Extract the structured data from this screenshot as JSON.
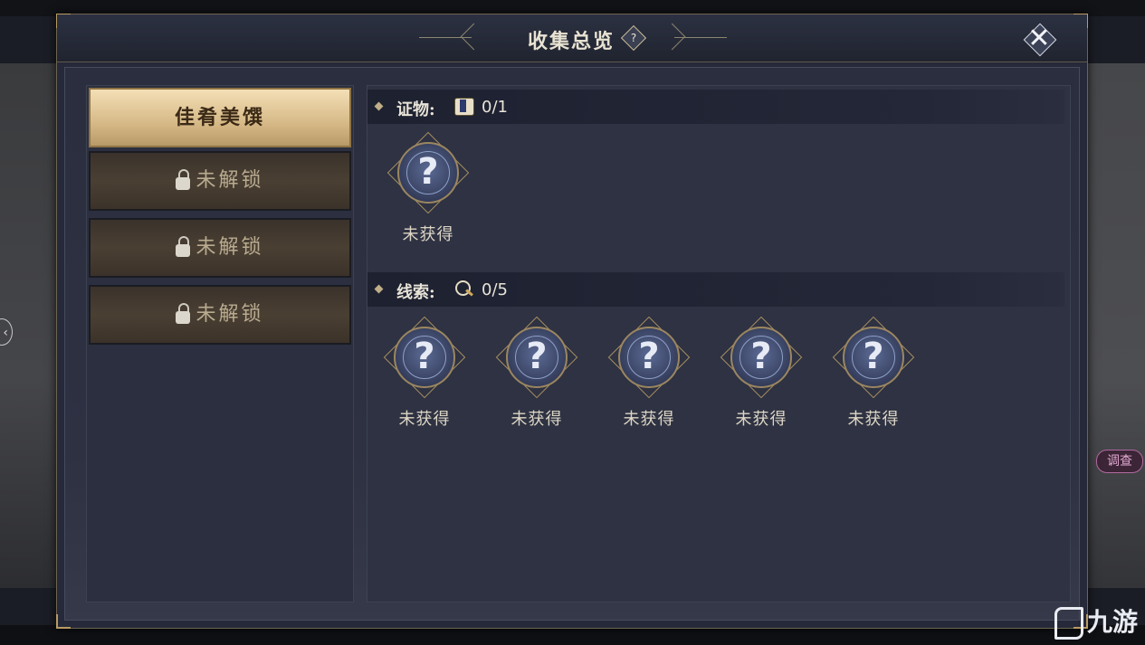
{
  "modal": {
    "title": "收集总览",
    "help_label": "?",
    "close_label": "✕"
  },
  "left_tabs": [
    {
      "label": "佳肴美馔",
      "state": "active"
    },
    {
      "label": "未解锁",
      "state": "locked"
    },
    {
      "label": "未解锁",
      "state": "locked"
    },
    {
      "label": "未解锁",
      "state": "locked"
    }
  ],
  "sections": {
    "evidence": {
      "label": "证物:",
      "icon": "scroll-icon",
      "count": "0/1",
      "items": [
        {
          "label": "未获得",
          "symbol": "?"
        }
      ]
    },
    "clues": {
      "label": "线索:",
      "icon": "magnifier-icon",
      "count": "0/5",
      "items": [
        {
          "label": "未获得",
          "symbol": "?"
        },
        {
          "label": "未获得",
          "symbol": "?"
        },
        {
          "label": "未获得",
          "symbol": "?"
        },
        {
          "label": "未获得",
          "symbol": "?"
        },
        {
          "label": "未获得",
          "symbol": "?"
        }
      ]
    }
  },
  "background": {
    "side_arrow": "‹",
    "side_tag": "调查"
  },
  "watermark": "九游",
  "colors": {
    "panel_bg": "#252939",
    "active_tab": "#d6b987",
    "locked_tab": "#4a3f33",
    "gold_accent": "#b99b62",
    "text_light": "#e9e4d8"
  }
}
